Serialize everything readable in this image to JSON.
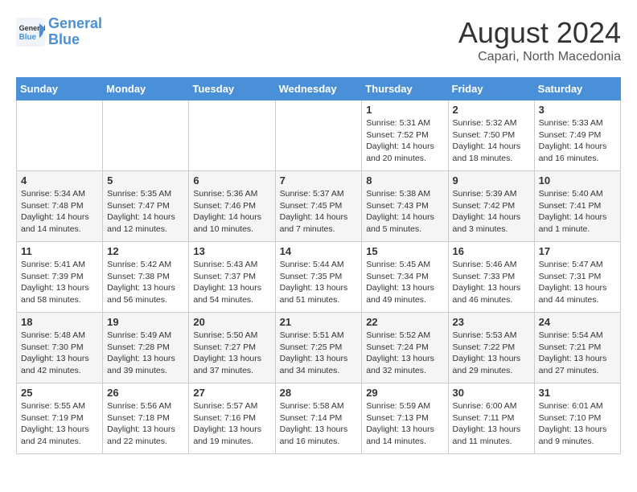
{
  "header": {
    "logo_line1": "General",
    "logo_line2": "Blue",
    "month_title": "August 2024",
    "subtitle": "Capari, North Macedonia"
  },
  "weekdays": [
    "Sunday",
    "Monday",
    "Tuesday",
    "Wednesday",
    "Thursday",
    "Friday",
    "Saturday"
  ],
  "weeks": [
    [
      {
        "day": "",
        "info": ""
      },
      {
        "day": "",
        "info": ""
      },
      {
        "day": "",
        "info": ""
      },
      {
        "day": "",
        "info": ""
      },
      {
        "day": "1",
        "info": "Sunrise: 5:31 AM\nSunset: 7:52 PM\nDaylight: 14 hours\nand 20 minutes."
      },
      {
        "day": "2",
        "info": "Sunrise: 5:32 AM\nSunset: 7:50 PM\nDaylight: 14 hours\nand 18 minutes."
      },
      {
        "day": "3",
        "info": "Sunrise: 5:33 AM\nSunset: 7:49 PM\nDaylight: 14 hours\nand 16 minutes."
      }
    ],
    [
      {
        "day": "4",
        "info": "Sunrise: 5:34 AM\nSunset: 7:48 PM\nDaylight: 14 hours\nand 14 minutes."
      },
      {
        "day": "5",
        "info": "Sunrise: 5:35 AM\nSunset: 7:47 PM\nDaylight: 14 hours\nand 12 minutes."
      },
      {
        "day": "6",
        "info": "Sunrise: 5:36 AM\nSunset: 7:46 PM\nDaylight: 14 hours\nand 10 minutes."
      },
      {
        "day": "7",
        "info": "Sunrise: 5:37 AM\nSunset: 7:45 PM\nDaylight: 14 hours\nand 7 minutes."
      },
      {
        "day": "8",
        "info": "Sunrise: 5:38 AM\nSunset: 7:43 PM\nDaylight: 14 hours\nand 5 minutes."
      },
      {
        "day": "9",
        "info": "Sunrise: 5:39 AM\nSunset: 7:42 PM\nDaylight: 14 hours\nand 3 minutes."
      },
      {
        "day": "10",
        "info": "Sunrise: 5:40 AM\nSunset: 7:41 PM\nDaylight: 14 hours\nand 1 minute."
      }
    ],
    [
      {
        "day": "11",
        "info": "Sunrise: 5:41 AM\nSunset: 7:39 PM\nDaylight: 13 hours\nand 58 minutes."
      },
      {
        "day": "12",
        "info": "Sunrise: 5:42 AM\nSunset: 7:38 PM\nDaylight: 13 hours\nand 56 minutes."
      },
      {
        "day": "13",
        "info": "Sunrise: 5:43 AM\nSunset: 7:37 PM\nDaylight: 13 hours\nand 54 minutes."
      },
      {
        "day": "14",
        "info": "Sunrise: 5:44 AM\nSunset: 7:35 PM\nDaylight: 13 hours\nand 51 minutes."
      },
      {
        "day": "15",
        "info": "Sunrise: 5:45 AM\nSunset: 7:34 PM\nDaylight: 13 hours\nand 49 minutes."
      },
      {
        "day": "16",
        "info": "Sunrise: 5:46 AM\nSunset: 7:33 PM\nDaylight: 13 hours\nand 46 minutes."
      },
      {
        "day": "17",
        "info": "Sunrise: 5:47 AM\nSunset: 7:31 PM\nDaylight: 13 hours\nand 44 minutes."
      }
    ],
    [
      {
        "day": "18",
        "info": "Sunrise: 5:48 AM\nSunset: 7:30 PM\nDaylight: 13 hours\nand 42 minutes."
      },
      {
        "day": "19",
        "info": "Sunrise: 5:49 AM\nSunset: 7:28 PM\nDaylight: 13 hours\nand 39 minutes."
      },
      {
        "day": "20",
        "info": "Sunrise: 5:50 AM\nSunset: 7:27 PM\nDaylight: 13 hours\nand 37 minutes."
      },
      {
        "day": "21",
        "info": "Sunrise: 5:51 AM\nSunset: 7:25 PM\nDaylight: 13 hours\nand 34 minutes."
      },
      {
        "day": "22",
        "info": "Sunrise: 5:52 AM\nSunset: 7:24 PM\nDaylight: 13 hours\nand 32 minutes."
      },
      {
        "day": "23",
        "info": "Sunrise: 5:53 AM\nSunset: 7:22 PM\nDaylight: 13 hours\nand 29 minutes."
      },
      {
        "day": "24",
        "info": "Sunrise: 5:54 AM\nSunset: 7:21 PM\nDaylight: 13 hours\nand 27 minutes."
      }
    ],
    [
      {
        "day": "25",
        "info": "Sunrise: 5:55 AM\nSunset: 7:19 PM\nDaylight: 13 hours\nand 24 minutes."
      },
      {
        "day": "26",
        "info": "Sunrise: 5:56 AM\nSunset: 7:18 PM\nDaylight: 13 hours\nand 22 minutes."
      },
      {
        "day": "27",
        "info": "Sunrise: 5:57 AM\nSunset: 7:16 PM\nDaylight: 13 hours\nand 19 minutes."
      },
      {
        "day": "28",
        "info": "Sunrise: 5:58 AM\nSunset: 7:14 PM\nDaylight: 13 hours\nand 16 minutes."
      },
      {
        "day": "29",
        "info": "Sunrise: 5:59 AM\nSunset: 7:13 PM\nDaylight: 13 hours\nand 14 minutes."
      },
      {
        "day": "30",
        "info": "Sunrise: 6:00 AM\nSunset: 7:11 PM\nDaylight: 13 hours\nand 11 minutes."
      },
      {
        "day": "31",
        "info": "Sunrise: 6:01 AM\nSunset: 7:10 PM\nDaylight: 13 hours\nand 9 minutes."
      }
    ]
  ]
}
